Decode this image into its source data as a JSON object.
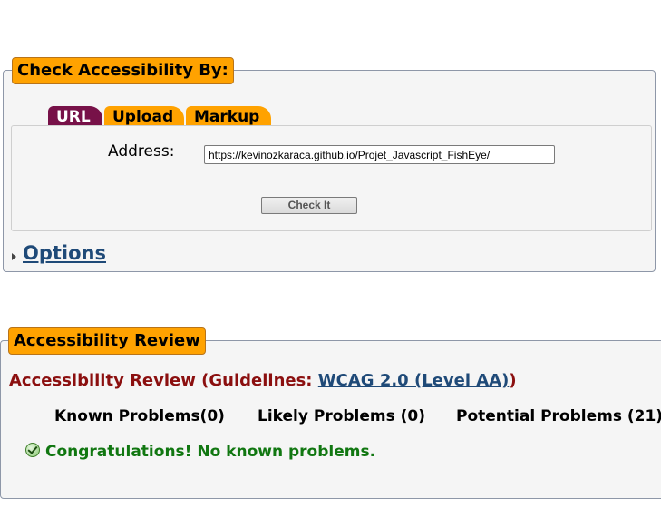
{
  "check_section": {
    "legend": "Check Accessibility By:",
    "tabs": [
      {
        "label": "URL",
        "active": true
      },
      {
        "label": "Upload",
        "active": false
      },
      {
        "label": "Markup",
        "active": false
      }
    ],
    "address_label": "Address:",
    "address_value": "https://kevinozkaraca.github.io/Projet_Javascript_FishEye/",
    "check_button": "Check It",
    "options_link": "Options"
  },
  "review_section": {
    "legend": "Accessibility Review",
    "heading_prefix": "Accessibility Review (Guidelines: ",
    "guideline_link": "WCAG 2.0 (Level AA)",
    "heading_suffix": ")",
    "tabs": [
      {
        "label": "Known Problems(0)",
        "active": true
      },
      {
        "label": "Likely Problems (0)",
        "active": false
      },
      {
        "label": "Potential Problems (21)",
        "active": false
      }
    ],
    "message": "Congratulations! No known problems."
  },
  "colors": {
    "legend_bg": "#ffa200",
    "active_tab_bg": "#771148",
    "link": "#1f4a78",
    "review_heading": "#8b0f0f",
    "success_text": "#117711"
  }
}
